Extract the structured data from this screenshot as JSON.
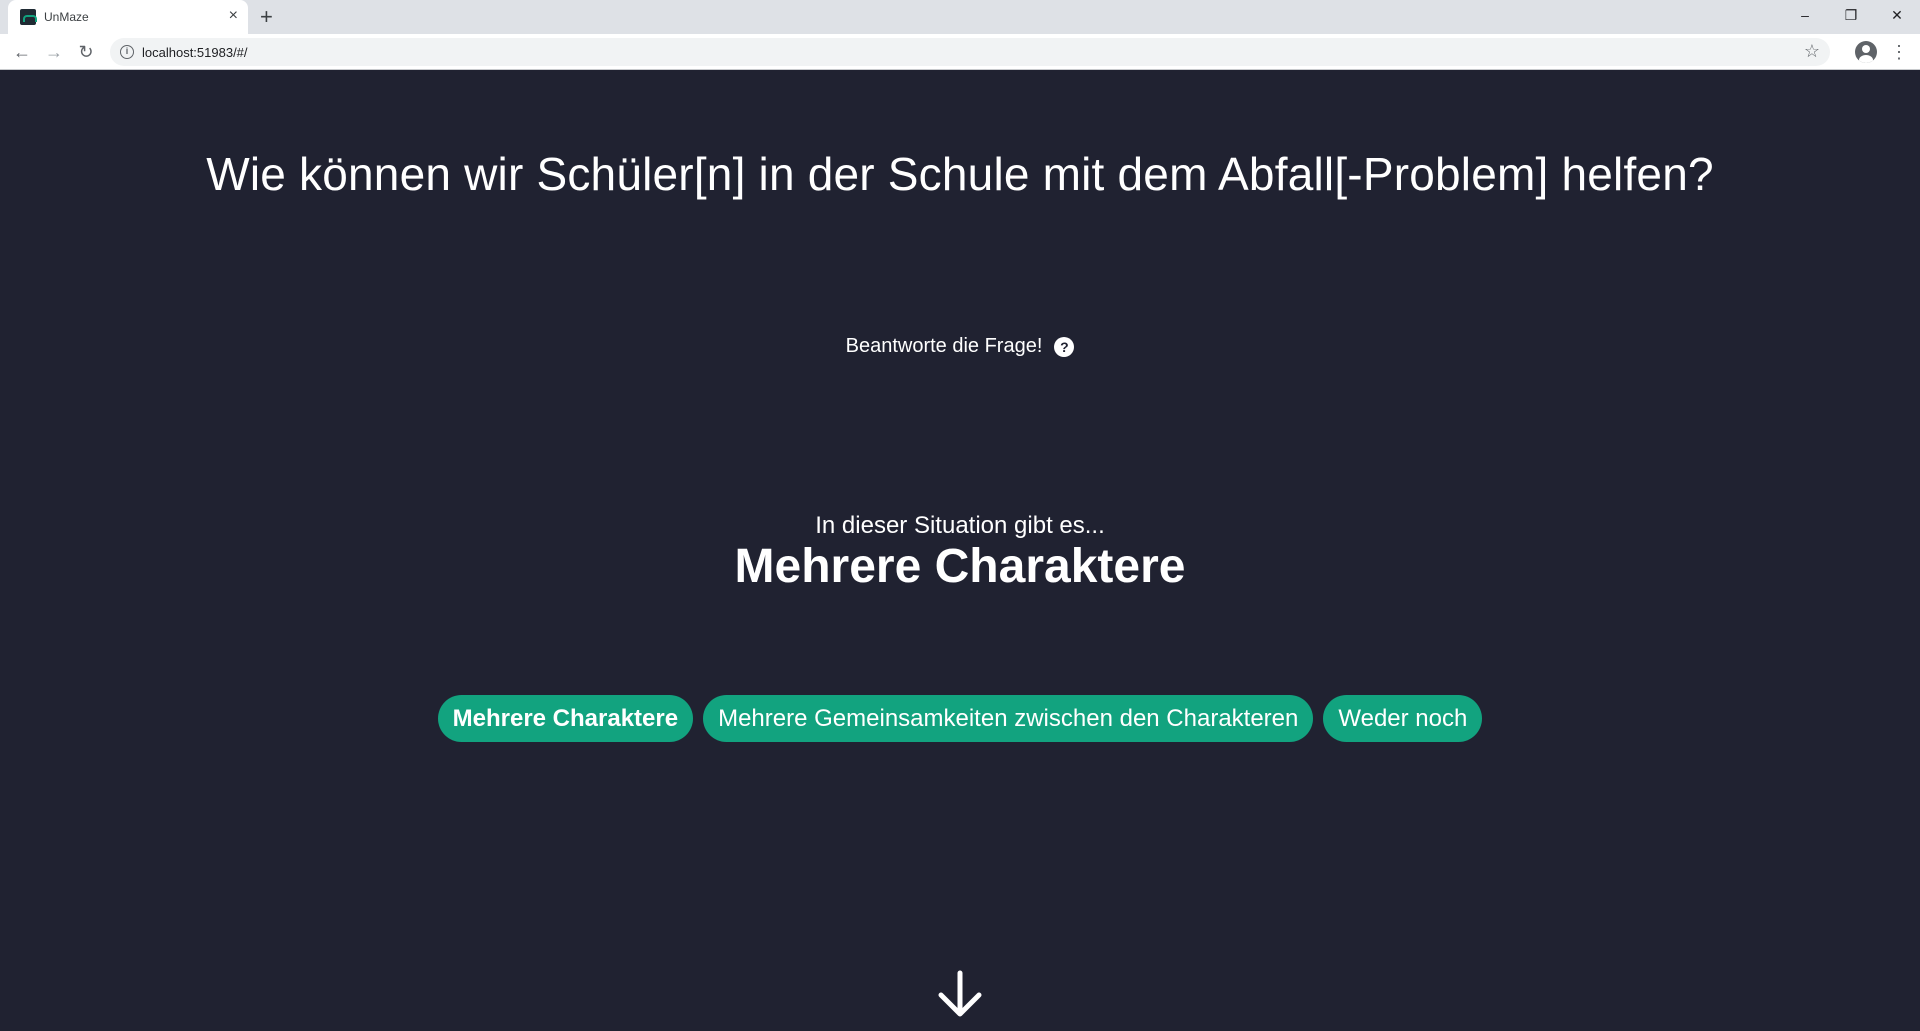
{
  "browser": {
    "tab_title": "UnMaze",
    "tab_close": "×",
    "new_tab": "+",
    "url": "localhost:51983/#/",
    "controls": {
      "minimize": "–",
      "restore": "❐",
      "close": "✕"
    },
    "nav": {
      "back": "←",
      "forward": "→",
      "reload": "↻"
    },
    "info_glyph": "i",
    "star_glyph": "☆",
    "menu_glyph": "⋮"
  },
  "page": {
    "question": "Wie können wir Schüler[n] in der Schule mit dem Abfall[-Problem] helfen?",
    "instruction": "Beantworte die Frage!",
    "help_glyph": "?",
    "situation_intro": "In dieser Situation gibt es...",
    "situation_value": "Mehrere Charaktere",
    "options": [
      {
        "label": "Mehrere Charaktere",
        "selected": true
      },
      {
        "label": "Mehrere Gemeinsamkeiten zwischen den Charakteren",
        "selected": false
      },
      {
        "label": "Weder noch",
        "selected": false
      }
    ]
  },
  "colors": {
    "background": "#202231",
    "accent": "#12a37f",
    "text": "#ffffff"
  }
}
